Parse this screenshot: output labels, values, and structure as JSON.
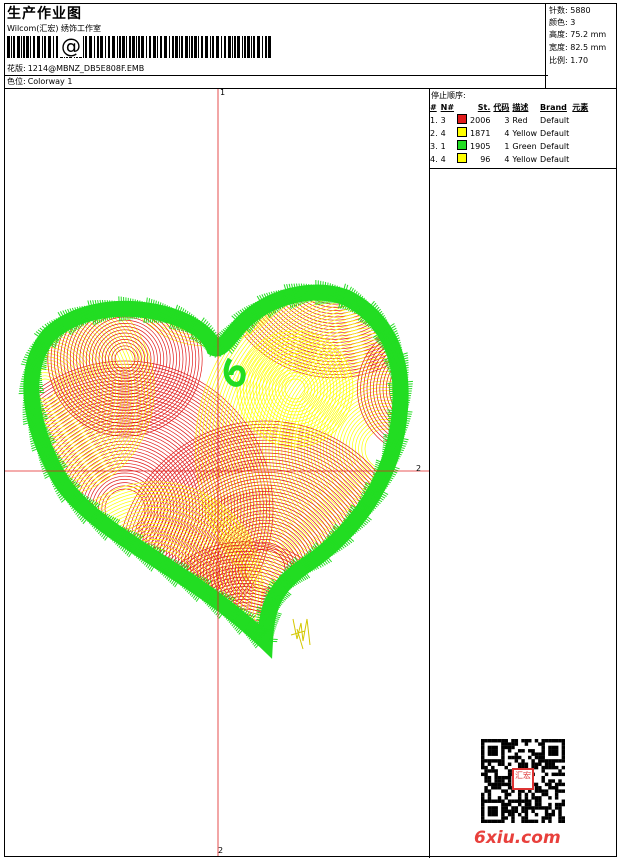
{
  "header": {
    "title": "生产作业图",
    "studio": "Wilcom(汇宏) 绣饰工作室",
    "barcode_char": "@",
    "design_label": "花版:",
    "design_file": "1214@MBNZ_DB5E808F.EMB",
    "colorway_label": "色位:",
    "colorway": "Colorway 1"
  },
  "stats": [
    {
      "label": "针数:",
      "value": "5880"
    },
    {
      "label": "颜色:",
      "value": "3"
    },
    {
      "label": "高度:",
      "value": "75.2 mm"
    },
    {
      "label": "宽度:",
      "value": "82.5 mm"
    },
    {
      "label": "比例:",
      "value": "1.70"
    }
  ],
  "stop_sequence": {
    "title": "停止顺序:",
    "columns": [
      "#",
      "N#",
      "St.",
      "代码",
      "描述",
      "Brand",
      "元素"
    ],
    "rows": [
      {
        "idx": "1.",
        "n": "3",
        "color": "#e11b1b",
        "stitches": "2006",
        "code": "3",
        "desc": "Red",
        "brand": "Default"
      },
      {
        "idx": "2.",
        "n": "4",
        "color": "#ffff00",
        "stitches": "1871",
        "code": "4",
        "desc": "Yellow",
        "brand": "Default"
      },
      {
        "idx": "3.",
        "n": "1",
        "color": "#22dd22",
        "stitches": "1905",
        "code": "1",
        "desc": "Green",
        "brand": "Default"
      },
      {
        "idx": "4.",
        "n": "4",
        "color": "#ffff00",
        "stitches": "96",
        "code": "4",
        "desc": "Yellow",
        "brand": "Default"
      }
    ]
  },
  "canvas": {
    "axis_labels": {
      "top": "1",
      "bottom": "2",
      "right": "2"
    },
    "thread_colors": {
      "red": "#e11b1b",
      "yellow": "#ffff00",
      "green": "#22dd22",
      "axis": "#e02020"
    }
  },
  "watermark": {
    "site": "6xiu.com",
    "stamp_text": "汇宏"
  }
}
